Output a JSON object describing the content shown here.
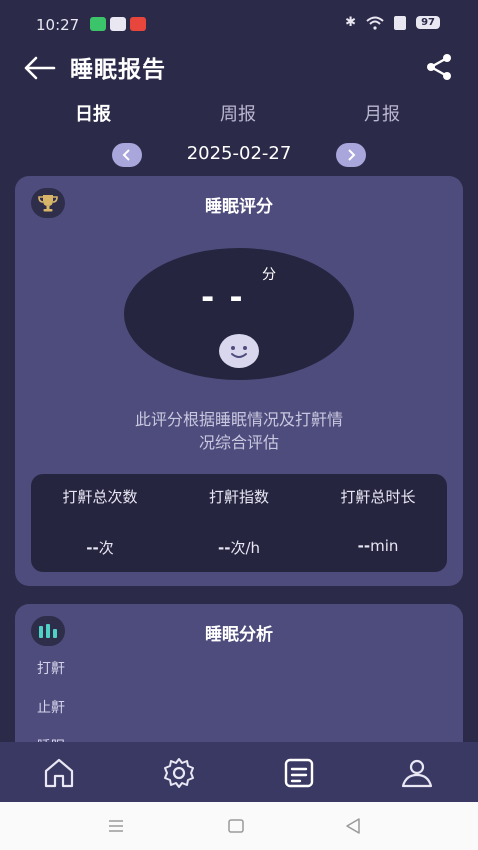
{
  "status": {
    "time": "10:27",
    "battery": "97"
  },
  "header": {
    "title": "睡眠报告"
  },
  "tabs": [
    {
      "label": "日报"
    },
    {
      "label": "周报"
    },
    {
      "label": "月报"
    }
  ],
  "date": "2025-02-27",
  "score_card": {
    "title": "睡眠评分",
    "score": "- -",
    "unit": "分",
    "description_line1": "此评分根据睡眠情况及打鼾情",
    "description_line2": "况综合评估",
    "stats": [
      {
        "label": "打鼾总次数",
        "value": "--",
        "unit": "次"
      },
      {
        "label": "打鼾指数",
        "value": "--",
        "unit": "次/h"
      },
      {
        "label": "打鼾总时长",
        "value": "--",
        "unit": "min"
      }
    ]
  },
  "analysis_card": {
    "title": "睡眠分析",
    "categories": [
      "打鼾",
      "止鼾",
      "睡眠"
    ]
  },
  "colors": {
    "background": "#2b2a49",
    "card": "#4e4c7c",
    "dark_panel": "#262540",
    "accent": "#4fd1c5",
    "navbar": "#3a3963"
  },
  "icons": {
    "back": "arrow-left-icon",
    "share": "share-icon",
    "trophy": "trophy-icon",
    "chart": "bar-chart-icon",
    "nav": [
      "home-icon",
      "gear-icon",
      "report-icon",
      "user-icon"
    ]
  }
}
